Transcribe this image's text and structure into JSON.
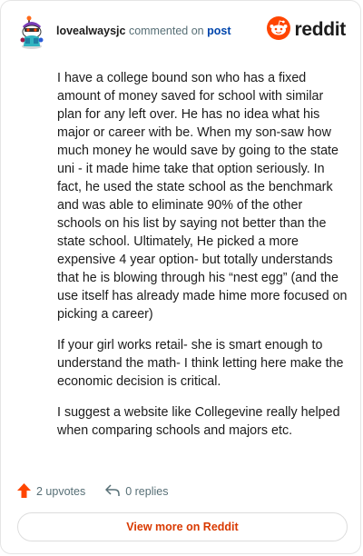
{
  "header": {
    "username": "lovealwaysjc",
    "action": "commented on",
    "post_link": "post",
    "brand": "reddit",
    "icons": {
      "avatar": "snoo-avatar-icon",
      "brand": "reddit-logo-icon"
    }
  },
  "comment": {
    "paragraphs": [
      "I have a college bound son who has a fixed amount of money saved for school with similar plan for any left over. He has no idea what his major or career with be. When my son-saw how much money he would save by going to the state uni - it made hime take that option seriously. In fact, he used the state school as the benchmark and was able to eliminate 90% of the other schools on his list by saying not better than the state school. Ultimately, He picked a more expensive 4 year option- but totally understands that he is blowing through his “nest egg” (and the use itself has already made hime more focused on picking a career)",
      "If your girl works retail- she is smart enough to understand the math- I think letting here make the economic decision is critical.",
      "I suggest a website like Collegevine really helped when comparing schools and majors etc."
    ]
  },
  "footer": {
    "upvotes": "2 upvotes",
    "replies": "0 replies",
    "icons": {
      "upvote": "upvote-arrow-icon",
      "reply": "reply-icon"
    }
  },
  "cta": {
    "label": "View more on Reddit"
  },
  "colors": {
    "accent": "#ff4500",
    "link": "#0045ac",
    "muted": "#576f76",
    "cta": "#d93900"
  }
}
